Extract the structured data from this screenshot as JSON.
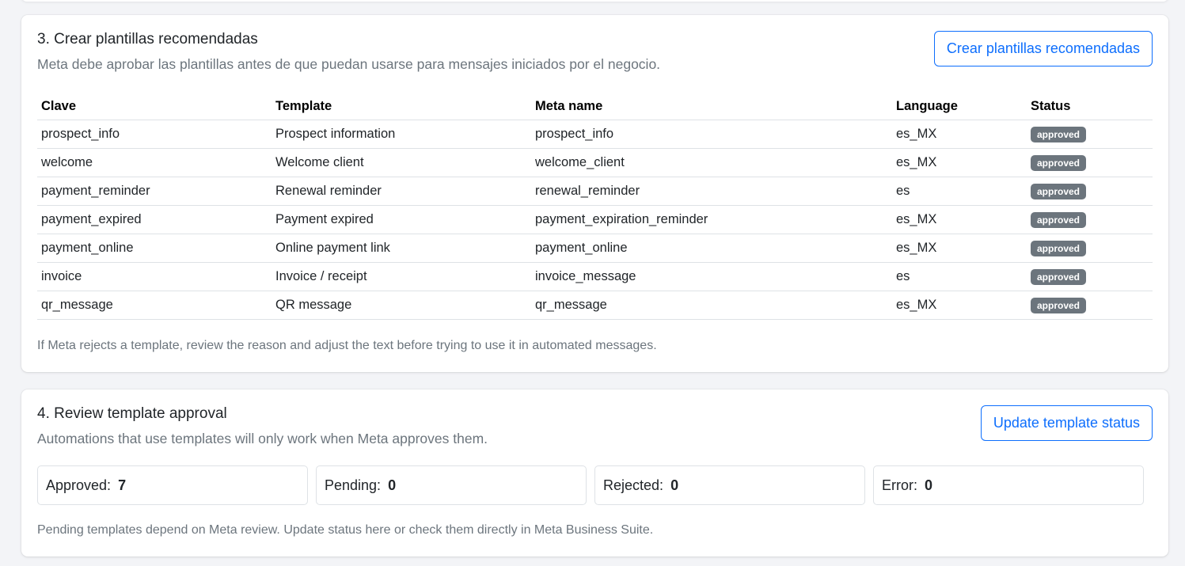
{
  "templates_card": {
    "title": "3. Crear plantillas recomendadas",
    "subtitle": "Meta debe aprobar las plantillas antes de que puedan usarse para mensajes iniciados por el negocio.",
    "create_button_label": "Crear plantillas recomendadas",
    "columns": [
      "Clave",
      "Template",
      "Meta name",
      "Language",
      "Status"
    ],
    "rows": [
      {
        "key": "prospect_info",
        "template": "Prospect information",
        "meta_name": "prospect_info",
        "language": "es_MX",
        "status": "approved"
      },
      {
        "key": "welcome",
        "template": "Welcome client",
        "meta_name": "welcome_client",
        "language": "es_MX",
        "status": "approved"
      },
      {
        "key": "payment_reminder",
        "template": "Renewal reminder",
        "meta_name": "renewal_reminder",
        "language": "es",
        "status": "approved"
      },
      {
        "key": "payment_expired",
        "template": "Payment expired",
        "meta_name": "payment_expiration_reminder",
        "language": "es_MX",
        "status": "approved"
      },
      {
        "key": "payment_online",
        "template": "Online payment link",
        "meta_name": "payment_online",
        "language": "es_MX",
        "status": "approved"
      },
      {
        "key": "invoice",
        "template": "Invoice / receipt",
        "meta_name": "invoice_message",
        "language": "es",
        "status": "approved"
      },
      {
        "key": "qr_message",
        "template": "QR message",
        "meta_name": "qr_message",
        "language": "es_MX",
        "status": "approved"
      }
    ],
    "footer_note": "If Meta rejects a template, review the reason and adjust the text before trying to use it in automated messages."
  },
  "approval_card": {
    "title": "4. Review template approval",
    "subtitle": "Automations that use templates will only work when Meta approves them.",
    "update_button_label": "Update template status",
    "stats": [
      {
        "label": "Approved:",
        "value": "7"
      },
      {
        "label": "Pending:",
        "value": "0"
      },
      {
        "label": "Rejected:",
        "value": "0"
      },
      {
        "label": "Error:",
        "value": "0"
      }
    ],
    "footer_note": "Pending templates depend on Meta review. Update status here or check them directly in Meta Business Suite."
  },
  "colors": {
    "accent": "#0d6efd",
    "badge_bg": "#6c757d",
    "muted_text": "#6c757d",
    "page_bg": "#f3f4f7"
  }
}
